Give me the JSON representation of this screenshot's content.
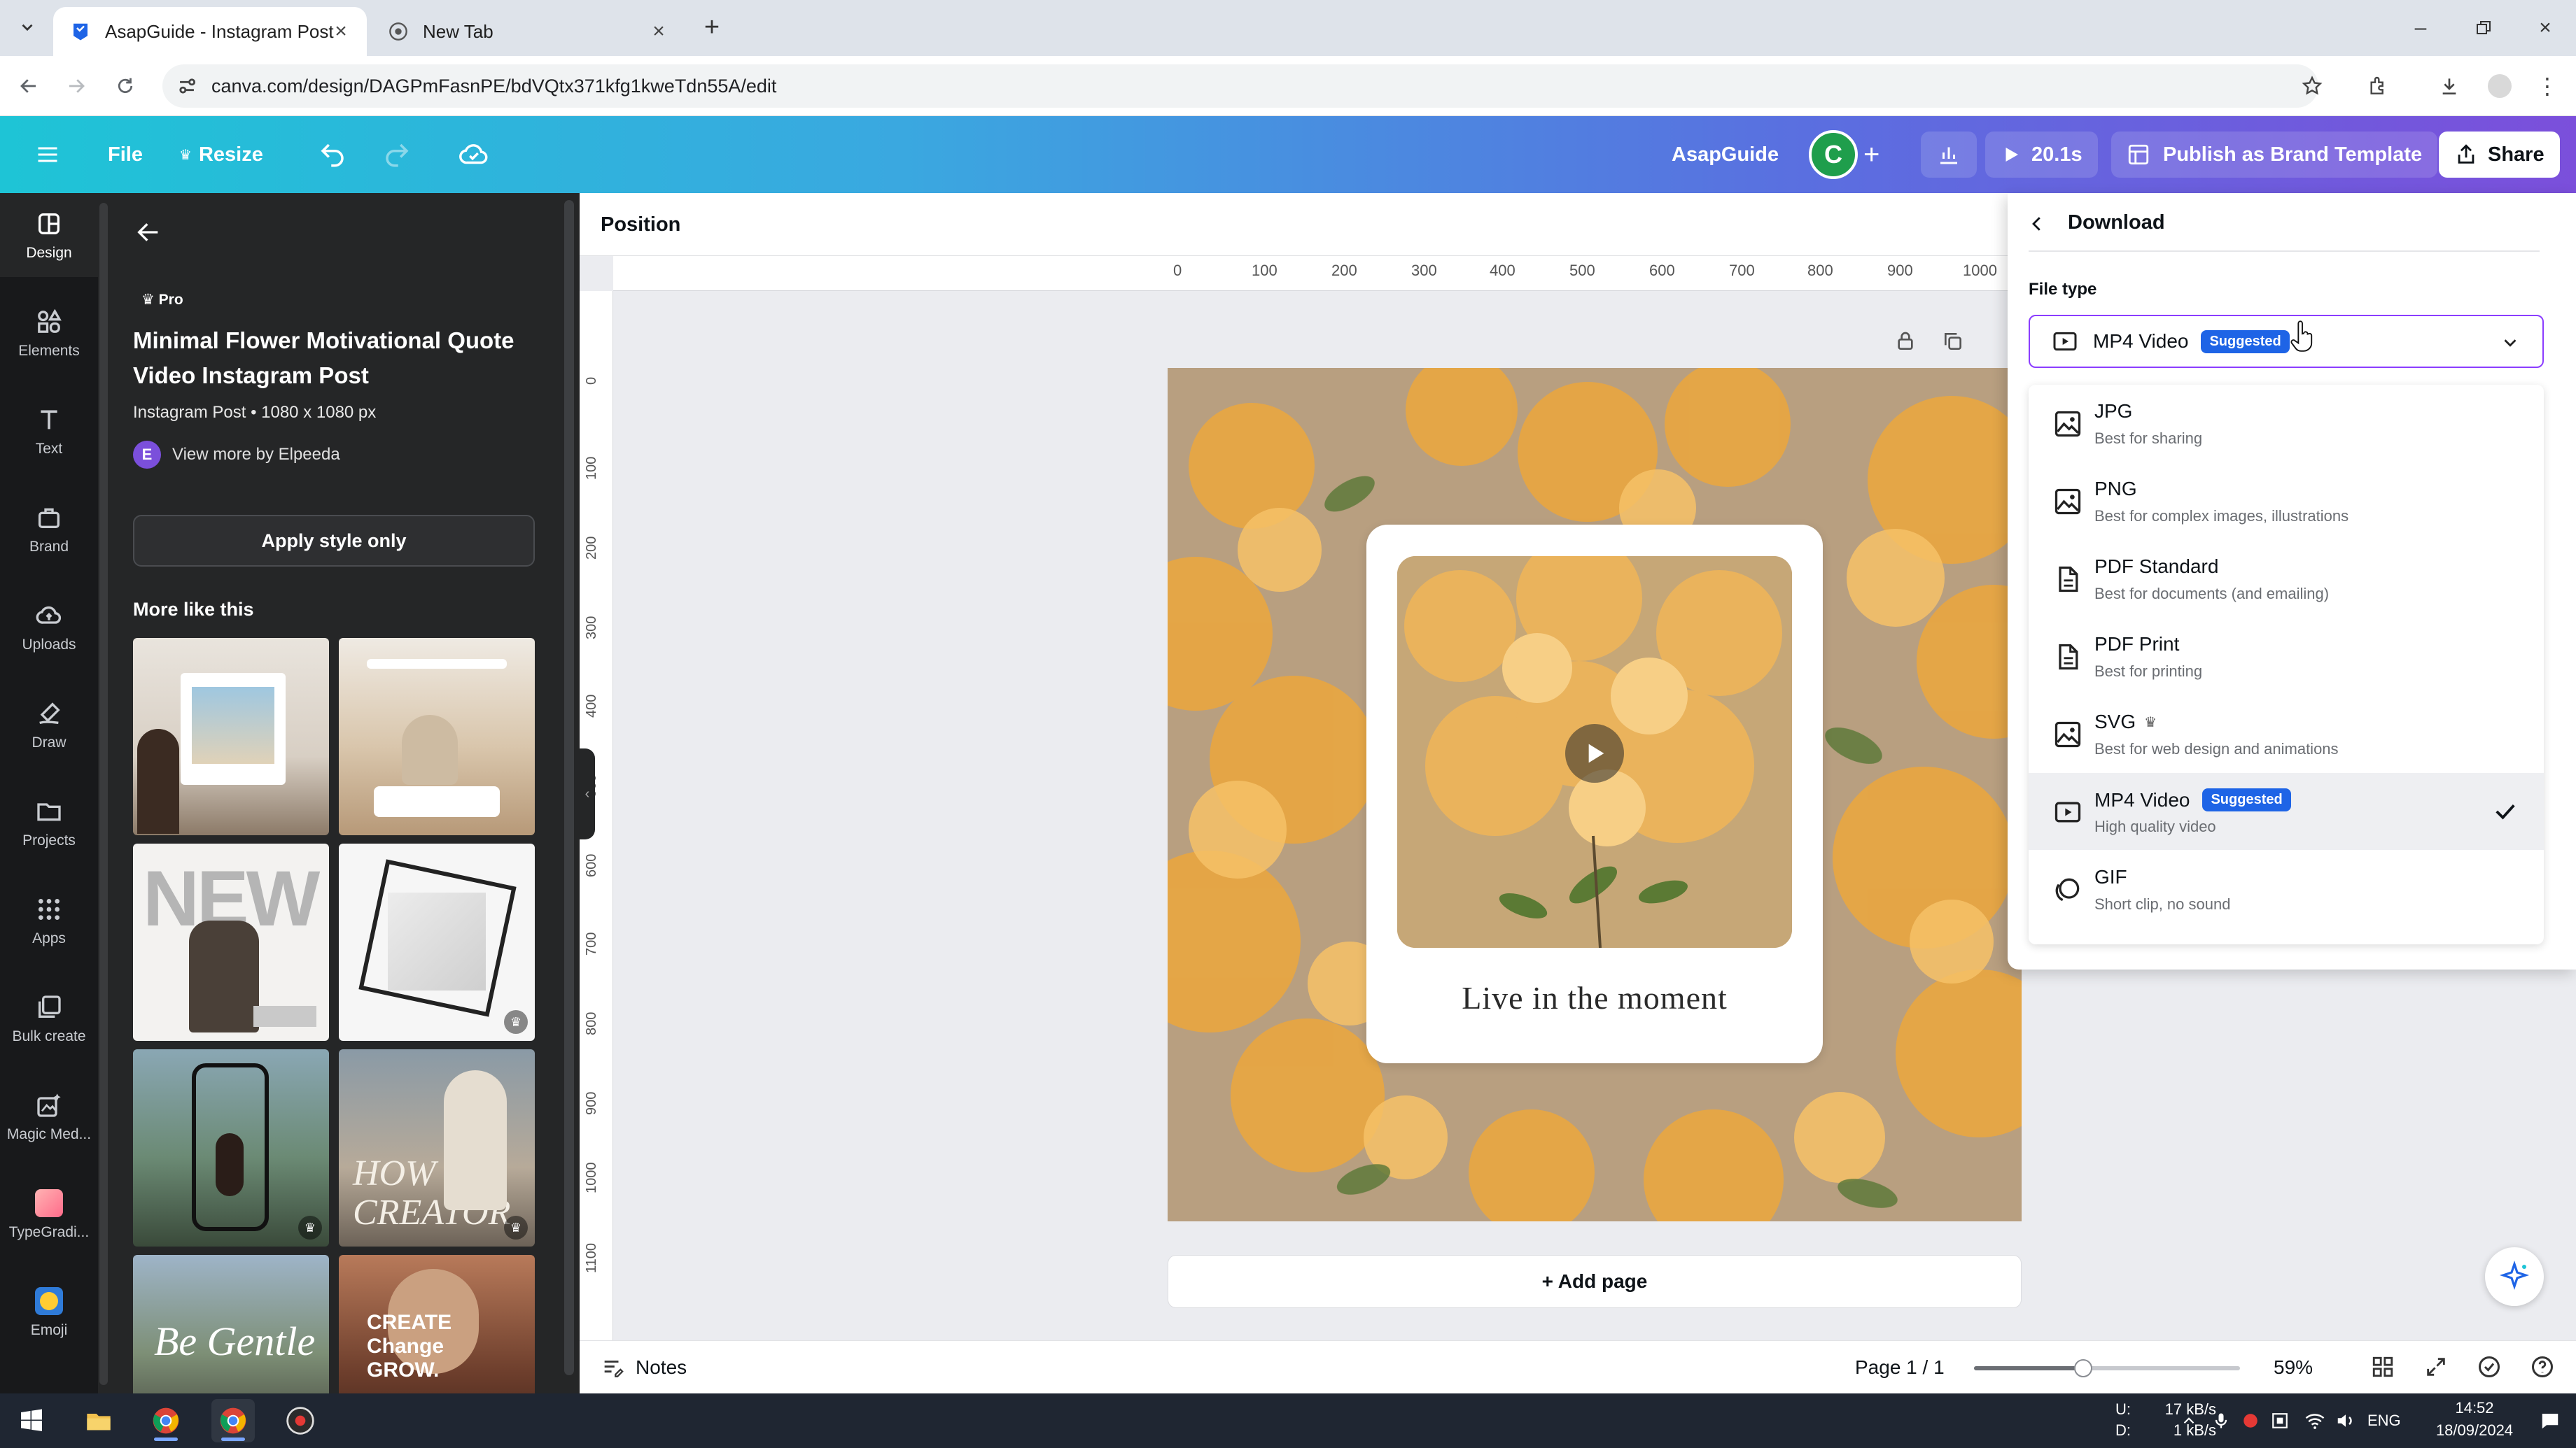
{
  "browser": {
    "tabs": [
      {
        "title": "AsapGuide - Instagram Post",
        "active": true
      },
      {
        "title": "New Tab",
        "active": false
      }
    ],
    "url": "canva.com/design/DAGPmFasnPE/bdVQtx371kfg1kweTdn55A/edit"
  },
  "topbar": {
    "file": "File",
    "resize": "Resize",
    "team_name": "AsapGuide",
    "avatar_letter": "C",
    "play_time": "20.1s",
    "publish": "Publish as Brand Template",
    "share": "Share"
  },
  "rail": [
    {
      "label": "Design",
      "icon": "design-icon"
    },
    {
      "label": "Elements",
      "icon": "elements-icon"
    },
    {
      "label": "Text",
      "icon": "text-icon"
    },
    {
      "label": "Brand",
      "icon": "brand-icon"
    },
    {
      "label": "Uploads",
      "icon": "uploads-icon"
    },
    {
      "label": "Draw",
      "icon": "draw-icon"
    },
    {
      "label": "Projects",
      "icon": "projects-icon"
    },
    {
      "label": "Apps",
      "icon": "apps-icon"
    },
    {
      "label": "Bulk create",
      "icon": "bulk-create-icon"
    },
    {
      "label": "Magic Med...",
      "icon": "magic-media-icon"
    },
    {
      "label": "TypeGradi...",
      "icon": "typegradient-icon"
    },
    {
      "label": "Emoji",
      "icon": "emoji-icon"
    }
  ],
  "panel": {
    "badge": "Pro",
    "title": "Minimal Flower Motivational Quote Video Instagram Post",
    "meta": "Instagram Post • 1080 x 1080 px",
    "author_initial": "E",
    "author": "View more by Elpeeda",
    "apply_button": "Apply style only",
    "more_like": "More like this"
  },
  "editor": {
    "position_label": "Position",
    "ruler_h": [
      "0",
      "100",
      "200",
      "300",
      "400",
      "500",
      "600",
      "700",
      "800",
      "900",
      "1000"
    ],
    "ruler_v": [
      "0",
      "100",
      "200",
      "300",
      "400",
      "500",
      "600",
      "700",
      "800",
      "900",
      "1000",
      "1100"
    ],
    "quote": "Live in the moment",
    "add_page": "+ Add page"
  },
  "bottombar": {
    "notes": "Notes",
    "page": "Page 1 / 1",
    "zoom": "59%",
    "zoom_fraction": 0.41
  },
  "download": {
    "title": "Download",
    "file_type_label": "File type",
    "selected": "MP4 Video",
    "suggested": "Suggested",
    "options": [
      {
        "name": "JPG",
        "desc": "Best for sharing",
        "icon": "image-icon",
        "pro": false,
        "suggested": false,
        "selected": false
      },
      {
        "name": "PNG",
        "desc": "Best for complex images, illustrations",
        "icon": "image-icon",
        "pro": false,
        "suggested": false,
        "selected": false
      },
      {
        "name": "PDF Standard",
        "desc": "Best for documents (and emailing)",
        "icon": "document-icon",
        "pro": false,
        "suggested": false,
        "selected": false
      },
      {
        "name": "PDF Print",
        "desc": "Best for printing",
        "icon": "document-icon",
        "pro": false,
        "suggested": false,
        "selected": false
      },
      {
        "name": "SVG",
        "desc": "Best for web design and animations",
        "icon": "image-icon",
        "pro": true,
        "suggested": false,
        "selected": false
      },
      {
        "name": "MP4 Video",
        "desc": "High quality video",
        "icon": "video-icon",
        "pro": false,
        "suggested": true,
        "selected": true
      },
      {
        "name": "GIF",
        "desc": "Short clip, no sound",
        "icon": "gif-icon",
        "pro": false,
        "suggested": false,
        "selected": false
      }
    ]
  },
  "taskbar": {
    "net_up_label": "U:",
    "net_down_label": "D:",
    "net_up": "17 kB/s",
    "net_down": "1 kB/s",
    "lang": "ENG",
    "time": "14:52",
    "date": "18/09/2024"
  },
  "colors": {
    "accent": "#8b3dff",
    "suggested_badge": "#1e64e6",
    "panel_bg": "#252627",
    "rail_bg": "#18191b"
  }
}
